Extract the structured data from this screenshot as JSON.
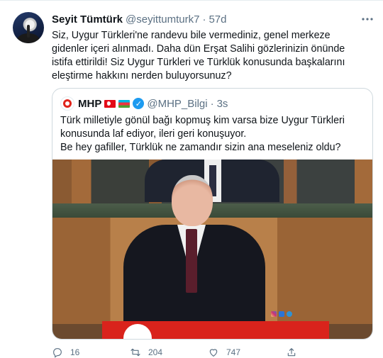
{
  "tweet": {
    "author_name": "Seyit Tümtürk",
    "author_handle": "@seyittumturk7",
    "separator": "·",
    "time": "57d",
    "text": "Siz, Uygur Türkleri'ne randevu bile vermediniz, genel merkeze gidenler içeri alınmadı. Daha dün Erşat Salihi gözlerinizin önünde istifa ettirildi! Siz Uygur Türkleri ve Türklük konusunda başkalarını eleştirme hakkını nerden buluyorsunuz?"
  },
  "quote": {
    "author_name": "MHP",
    "author_handle": "@MHP_Bilgi",
    "separator": "·",
    "time": "3s",
    "text_lines": [
      "Türk milletiyle gönül bağı kopmuş kim varsa bize Uygur Türkleri",
      "konusunda laf ediyor, ileri geri konuşuyor.",
      "Be hey gafiller, Türklük ne zamandır sizin ana meseleniz oldu?"
    ]
  },
  "actions": {
    "reply_count": "16",
    "retweet_count": "204",
    "like_count": "747"
  },
  "icons": {
    "more": "more-dots-icon",
    "reply": "reply-icon",
    "retweet": "retweet-icon",
    "like": "heart-icon",
    "share": "share-icon",
    "verified": "verified-badge-icon"
  },
  "colors": {
    "text_primary": "#0f1419",
    "text_secondary": "#5b7083",
    "border": "#cfd9de",
    "verified_blue": "#1d9bf0",
    "mhp_red": "#e0241b"
  }
}
